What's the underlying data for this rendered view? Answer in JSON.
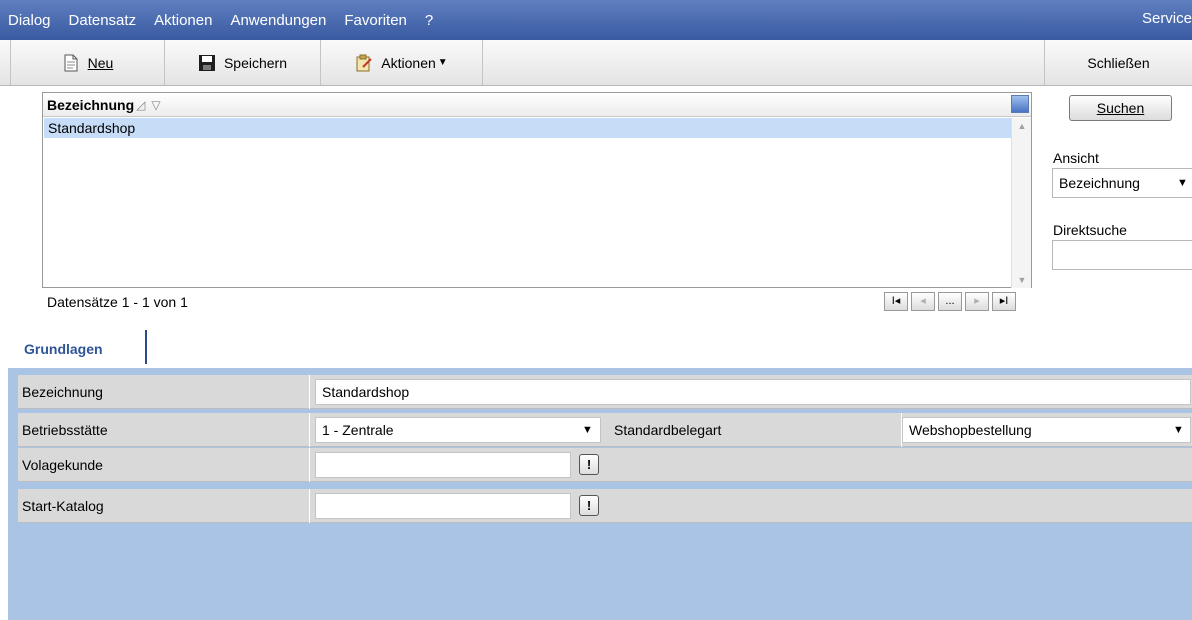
{
  "menu": {
    "items": [
      "Dialog",
      "Datensatz",
      "Aktionen",
      "Anwendungen",
      "Favoriten",
      "?"
    ],
    "right_label": "Service"
  },
  "toolbar": {
    "new_label": "Neu",
    "save_label": "Speichern",
    "actions_label": "Aktionen",
    "close_label": "Schließen"
  },
  "list": {
    "column_header": "Bezeichnung",
    "rows": [
      "Standardshop"
    ],
    "record_count": "Datensätze 1 - 1 von 1",
    "pager": {
      "first": "I◂",
      "prev": "◂",
      "more": "...",
      "next": "▸",
      "last": "▸I"
    }
  },
  "search_panel": {
    "search_button": "Suchen",
    "view_label": "Ansicht",
    "view_value": "Bezeichnung",
    "direct_search_label": "Direktsuche",
    "direct_search_value": ""
  },
  "tabs": [
    "Grundlagen"
  ],
  "form": {
    "bezeichnung": {
      "label": "Bezeichnung",
      "value": "Standardshop"
    },
    "betriebsstaette": {
      "label": "Betriebsstätte",
      "value": "1 - Zentrale"
    },
    "standardbelegart": {
      "label": "Standardbelegart",
      "value": "Webshopbestellung"
    },
    "volagekunde": {
      "label": "Volagekunde",
      "value": ""
    },
    "start_katalog": {
      "label": "Start-Katalog",
      "value": ""
    }
  },
  "colors": {
    "menubar": "#3a5aa2",
    "selection": "#c7dcf7",
    "form_background": "#a9c4e4",
    "tab_text": "#2f5597"
  }
}
